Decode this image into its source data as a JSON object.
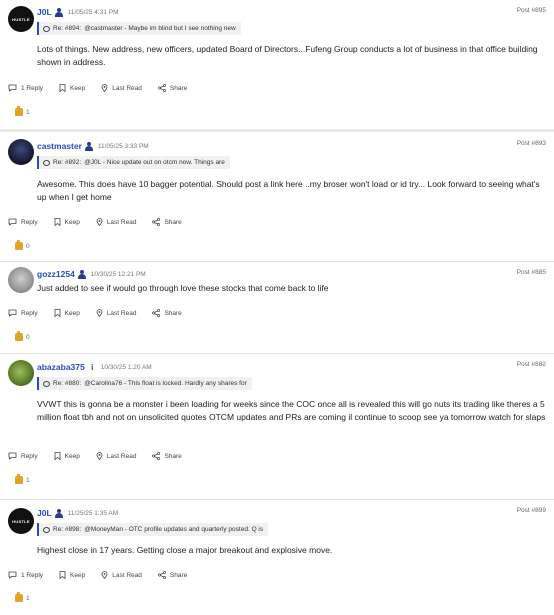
{
  "posts": [
    {
      "username": "J0L",
      "avatar": "hustle-logo-avatar",
      "avatar_text": "HUSTLE",
      "user_icon": "person-icon",
      "time": "11/05/25 4:31 PM",
      "post_number": "Post #895",
      "reply_ref": "Re: #894:",
      "reply_text": "@castmaster  - Maybe im blind but I see nothing new",
      "body": "Lots of things.  New address, new officers, updated Board of Directors...Fufeng Group conducts a lot of business in that office building shown in address.",
      "actions": {
        "reply": "1 Reply",
        "keep": "Keep",
        "last_read": "Last Read",
        "share": "Share"
      },
      "likes": "1"
    },
    {
      "username": "castmaster",
      "avatar": "tree-night-avatar",
      "user_icon": "person-icon",
      "time": "11/05/25 3:33 PM",
      "post_number": "Post #893",
      "reply_ref": "Re: #892:",
      "reply_text": "@J0L  - Nice update out on otcm now.  Things are",
      "body": "Awesome. This does have 10 bagger potential.  Should post a link here ..my broser won't load or id try... Look forward to seeing what's up when I get home",
      "actions": {
        "reply": "Reply",
        "keep": "Keep",
        "last_read": "Last Read",
        "share": "Share"
      },
      "likes": "0"
    },
    {
      "username": "gozz1254",
      "avatar": "gray-avatar",
      "user_icon": "person-icon",
      "time": "10/30/25 12:21 PM",
      "post_number": "Post #885",
      "body": "Just added to see if would go through love these stocks that come back to life",
      "actions": {
        "reply": "Reply",
        "keep": "Keep",
        "last_read": "Last Read",
        "share": "Share"
      },
      "likes": "0"
    },
    {
      "username": "abazaba375",
      "avatar": "green-avatar",
      "user_icon": "info-icon",
      "user_icon_text": "i",
      "time": "10/30/25 1:20 AM",
      "post_number": "Post #882",
      "reply_ref": "Re: #880:",
      "reply_text": "@Carolina76  - This float is locked. Hardly any shares for",
      "body": "VVWT this is gonna be a monster i been loading for weeks since the COC once all is revealed this will go nuts its trading like theres a 5 million float tbh and not on unsolicited quotes OTCM updates and PRs are coming il continue to scoop see ya tomorrow watch for slaps",
      "actions": {
        "reply": "Reply",
        "keep": "Keep",
        "last_read": "Last Read",
        "share": "Share"
      },
      "likes": "1"
    },
    {
      "username": "J0L",
      "avatar": "hustle-logo-avatar",
      "avatar_text": "HUSTLE",
      "user_icon": "person-icon",
      "time": "11/25/25 1:35 AM",
      "post_number": "Post #899",
      "reply_ref": "Re: #898:",
      "reply_text": "@MoneyMan  - OTC profile updates and quarterly posted. Q is",
      "body": "Highest close in 17 years.  Getting close a major breakout and explosive move.",
      "actions": {
        "reply": "1 Reply",
        "keep": "Keep",
        "last_read": "Last Read",
        "share": "Share"
      },
      "likes": "1"
    }
  ],
  "colors": {
    "username": "#2b4bbd",
    "reply_border": "#2b4bbd",
    "like": "#e0a526"
  }
}
